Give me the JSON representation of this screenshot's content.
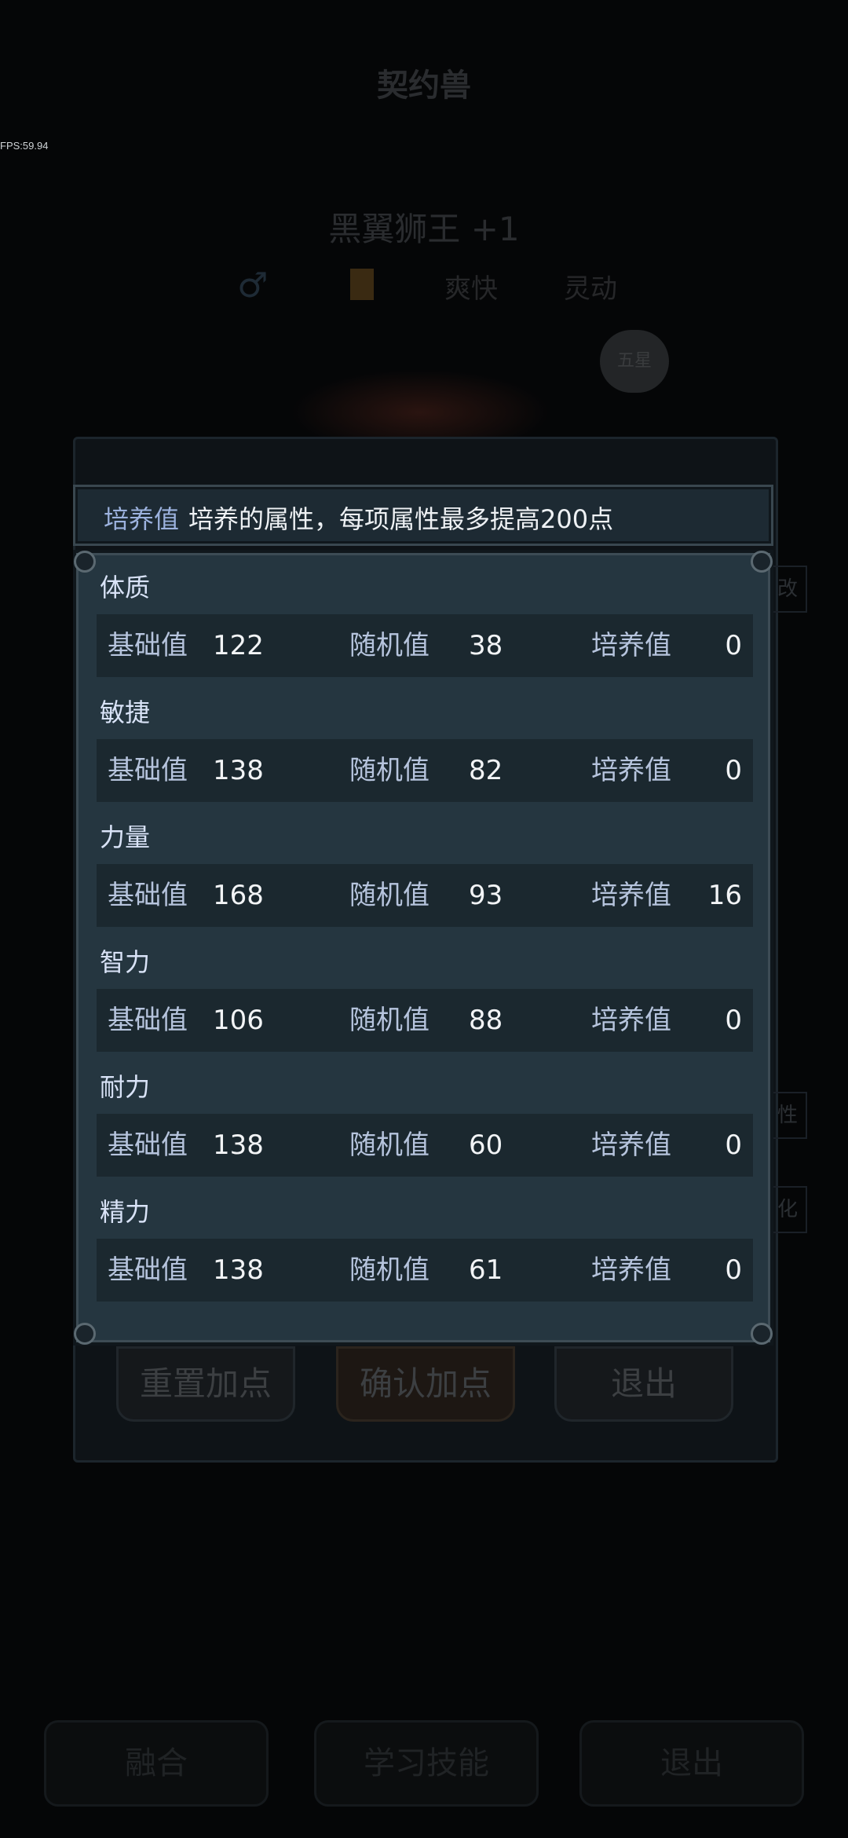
{
  "background": {
    "title": "契约兽",
    "fps": "FPS:59.94",
    "pet_name": "黑翼狮王 +1",
    "gender_symbol": "♂",
    "traits": [
      "爽快",
      "灵动"
    ],
    "badge": "五星",
    "panel_buttons": [
      "重置加点",
      "确认加点",
      "退出"
    ],
    "bottom_buttons": [
      "融合",
      "学习技能",
      "退出"
    ],
    "side_labels": [
      "改",
      "性",
      "化"
    ]
  },
  "header": {
    "tag": "培养值",
    "text": "培养的属性，每项属性最多提高200点"
  },
  "attributes": [
    {
      "name": "体质",
      "base_label": "基础值",
      "base": "122",
      "random_label": "随机值",
      "random": "38",
      "train_label": "培养值",
      "train": "0"
    },
    {
      "name": "敏捷",
      "base_label": "基础值",
      "base": "138",
      "random_label": "随机值",
      "random": "82",
      "train_label": "培养值",
      "train": "0"
    },
    {
      "name": "力量",
      "base_label": "基础值",
      "base": "168",
      "random_label": "随机值",
      "random": "93",
      "train_label": "培养值",
      "train": "16"
    },
    {
      "name": "智力",
      "base_label": "基础值",
      "base": "106",
      "random_label": "随机值",
      "random": "88",
      "train_label": "培养值",
      "train": "0"
    },
    {
      "name": "耐力",
      "base_label": "基础值",
      "base": "138",
      "random_label": "随机值",
      "random": "60",
      "train_label": "培养值",
      "train": "0"
    },
    {
      "name": "精力",
      "base_label": "基础值",
      "base": "138",
      "random_label": "随机值",
      "random": "61",
      "train_label": "培养值",
      "train": "0"
    }
  ]
}
